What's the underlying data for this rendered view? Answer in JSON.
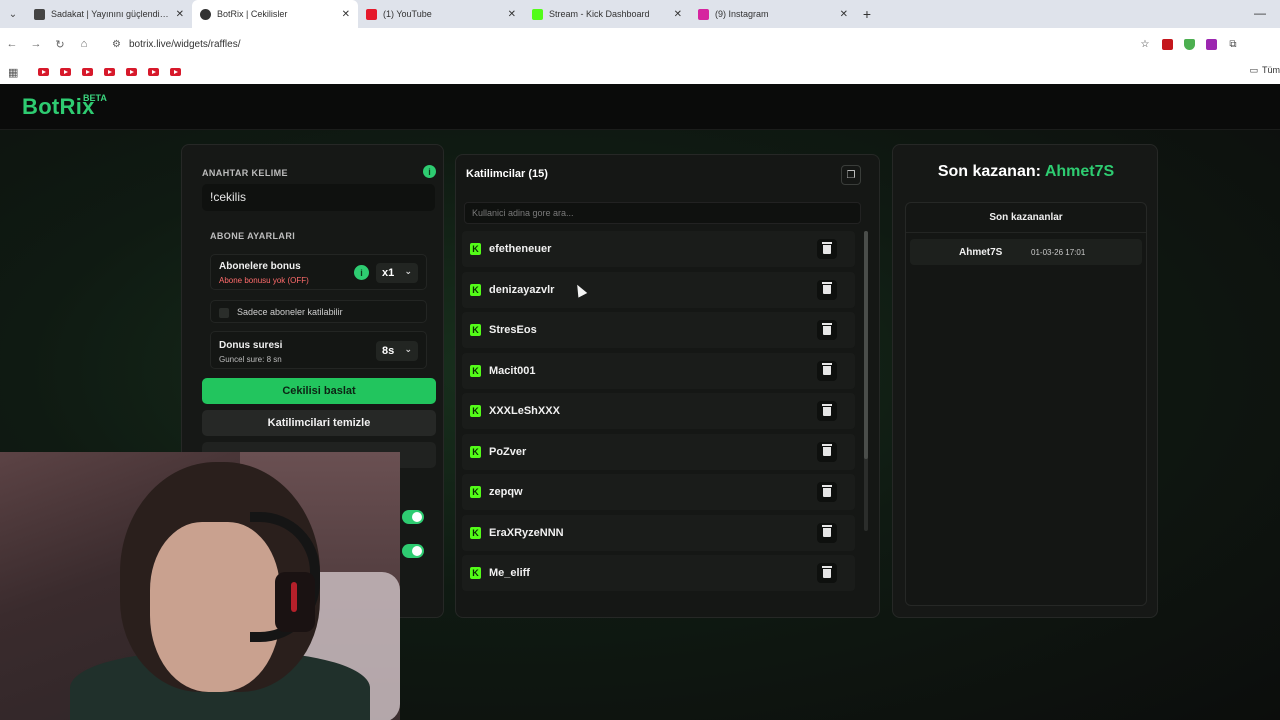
{
  "browser": {
    "tabs": [
      {
        "title": "Sadakat | Yayınını güçlendirmek",
        "favicon_color": "#444444",
        "active": false
      },
      {
        "title": "BotRix | Cekilisler",
        "favicon_color": "#333333",
        "active": true
      },
      {
        "title": "(1) YouTube",
        "favicon_color": "#e5192b",
        "active": false
      },
      {
        "title": "Stream - Kick Dashboard",
        "favicon_color": "#53fc18",
        "active": false
      },
      {
        "title": "(9) Instagram",
        "favicon_color": "#d6249f",
        "active": false
      }
    ],
    "url": "botrix.live/widgets/raffles/",
    "bookmarks_folder": "Tüm"
  },
  "app": {
    "logo": "BotRix",
    "logo_badge": "BETA",
    "keyword": {
      "label": "ANAHTAR KELIME",
      "value": "!cekilis"
    },
    "subscriber_settings": {
      "label": "ABONE AYARLARI",
      "bonus_title": "Abonelere bonus",
      "bonus_sub": "Abone bonusu yok (OFF)",
      "bonus_multiplier": "x1",
      "subs_only": "Sadece aboneler katilabilir",
      "duration_title": "Donus suresi",
      "duration_sub": "Guncel sure: 8 sn",
      "duration_value": "8s"
    },
    "start_button": "Cekilisi baslat",
    "clear_button": "Katilimcilari temizle",
    "participants": {
      "title": "Katilimcilar (15)",
      "search_placeholder": "Kullanici adina gore ara...",
      "items": [
        "efetheneuer",
        "denizayazvlr",
        "StresEos",
        "Macit001",
        "XXXLeShXXX",
        "PoZver",
        "zepqw",
        "EraXRyzeNNN",
        "Me_eliff"
      ]
    },
    "last_winner": {
      "prefix": "Son kazanan:",
      "name": "Ahmet7S",
      "list_title": "Son kazananlar",
      "rows": [
        {
          "name": "Ahmet7S",
          "date": "01-03-26 17:01"
        }
      ]
    },
    "colors": {
      "accent": "#2ecc71",
      "kick": "#53fc18"
    }
  }
}
